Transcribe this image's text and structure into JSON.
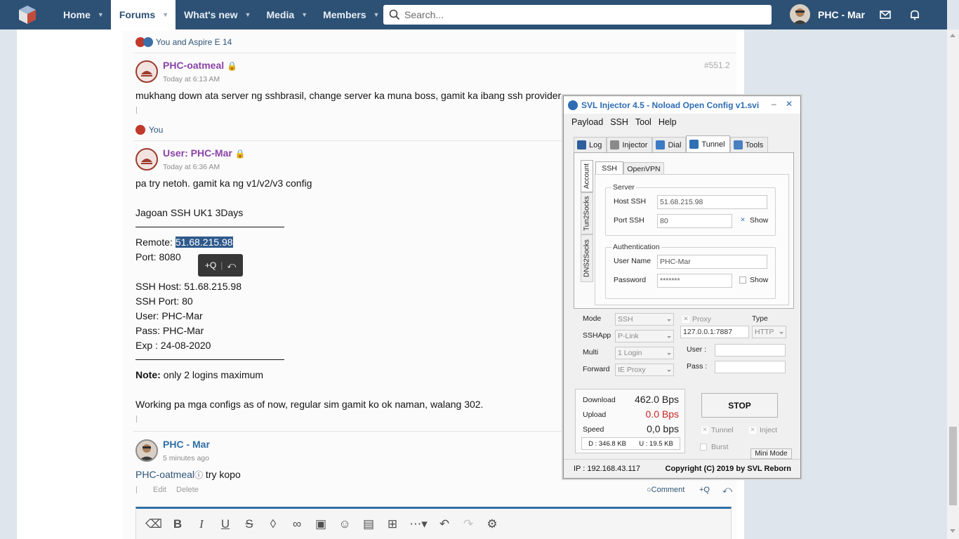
{
  "nav": {
    "tabs": [
      "Home",
      "Forums",
      "What's new",
      "Media",
      "Members"
    ],
    "search_placeholder": "Search...",
    "user_name": "PHC - Mar"
  },
  "posts": {
    "reaction1": "You and Aspire E 14",
    "post1": {
      "user": "PHC-oatmeal",
      "time": "Today at 6:13 AM",
      "number": "#551.2",
      "body": "mukhang down ata server ng sshbrasil, change server ka muna boss, gamit ka ibang ssh provider."
    },
    "reaction2": "You",
    "post2": {
      "user": "User: PHC-Mar",
      "time": "Today at 6:36 AM",
      "line1": "pa try netoh. gamit ka ng v1/v2/v3 config",
      "line2": "Jagoan SSH UK1 3Days",
      "remote_label": "Remote: ",
      "remote_value": "51.68.215.98",
      "port": "Port: 8080",
      "ssh_host": "SSH Host: 51.68.215.98",
      "ssh_port": "SSH Port: 80",
      "pass": "Pass: PHC-Mar",
      "exp": "Exp : 24-08-2020",
      "note_label": "Note:",
      "note_text": " only 2 logins maximum",
      "footer": "Working pa mga configs as of now, regular sim gamit ko ok naman, walang 302."
    },
    "quote_popup": "+Q",
    "post3": {
      "user": "PHC - Mar",
      "time": "5 minutes ago",
      "mention": "PHC-oatmeal",
      "body": " try kopo",
      "edit": "Edit",
      "delete": "Delete",
      "comment": "Comment",
      "quote": "+Q"
    }
  },
  "svl": {
    "title": "SVL Injector 4.5 - Noload Open Config v1.svi",
    "menu": [
      "Payload",
      "SSH",
      "Tool",
      "Help"
    ],
    "tabs": [
      "Log",
      "Injector",
      "Dial",
      "Tunnel",
      "Tools"
    ],
    "vtabs": [
      "Account",
      "Tun2Socks",
      "DNS2Socks"
    ],
    "subtabs": [
      "SSH",
      "OpenVPN"
    ],
    "server_group": "Server",
    "host_label": "Host SSH",
    "host_value": "51.68.215.98",
    "port_label": "Port SSH",
    "port_value": "80",
    "show": "Show",
    "auth_group": "Authentication",
    "username_label": "User Name",
    "username_value": "PHC-Mar",
    "password_label": "Password",
    "password_value": "*******",
    "mode_label": "Mode",
    "mode_value": "SSH",
    "proxy_label": "Proxy",
    "type_label": "Type",
    "sshapp_label": "SSHApp",
    "sshapp_value": "P-Link",
    "proxy_value": "127.0.0.1:7887",
    "type_value": "HTTP",
    "multi_label": "Multi",
    "multi_value": "1 Login",
    "user_label": "User  :",
    "forward_label": "Forward",
    "forward_value": "IE Proxy",
    "pass_label": "Pass  :",
    "download_label": "Download",
    "download_value": "462.0 Bps",
    "upload_label": "Upload",
    "upload_value": "0.0 Bps",
    "speed_label": "Speed",
    "speed_value": "0,0 bps",
    "d_total": "D :  346.8 KB",
    "u_total": "U :   19.5 KB",
    "stop": "STOP",
    "tunnel_chk": "Tunnel",
    "inject_chk": "Inject",
    "burst_chk": "Burst",
    "mini_mode": "Mini Mode",
    "ip": "IP : 192.168.43.117",
    "copyright": "Copyright (C) 2019 by SVL Reborn"
  }
}
